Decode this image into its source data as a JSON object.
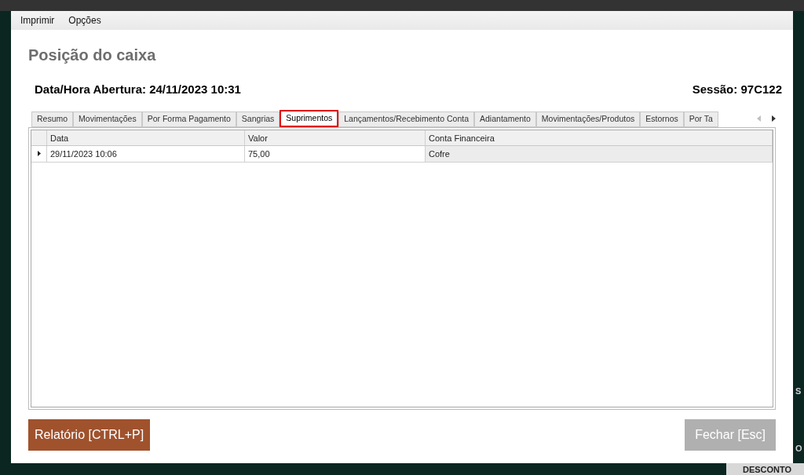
{
  "menu": [
    "Imprimir",
    "Opções"
  ],
  "title": "Posição do caixa",
  "opening": "Data/Hora Abertura: 24/11/2023 10:31",
  "session": "Sessão: 97C122",
  "tabs": [
    {
      "label": "Resumo",
      "selected": false
    },
    {
      "label": "Movimentações",
      "selected": false
    },
    {
      "label": "Por Forma Pagamento",
      "selected": false
    },
    {
      "label": "Sangrias",
      "selected": false
    },
    {
      "label": "Suprimentos",
      "selected": true
    },
    {
      "label": "Lançamentos/Recebimento Conta",
      "selected": false
    },
    {
      "label": "Adiantamento",
      "selected": false
    },
    {
      "label": "Movimentações/Produtos",
      "selected": false
    },
    {
      "label": "Estornos",
      "selected": false
    },
    {
      "label": "Por Ta",
      "selected": false
    }
  ],
  "table": {
    "columns": [
      "Data",
      "Valor",
      "Conta Financeira"
    ],
    "rows": [
      {
        "cells": [
          "29/11/2023 10:06",
          "75,00",
          "Cofre"
        ],
        "selected": true
      }
    ]
  },
  "buttons": [
    {
      "label": "Relatório [CTRL+P]",
      "disabled": false
    },
    {
      "label": "Fechar [Esc]",
      "disabled": true
    }
  ],
  "background_text": [
    "S",
    "O",
    "DESCONTO"
  ]
}
